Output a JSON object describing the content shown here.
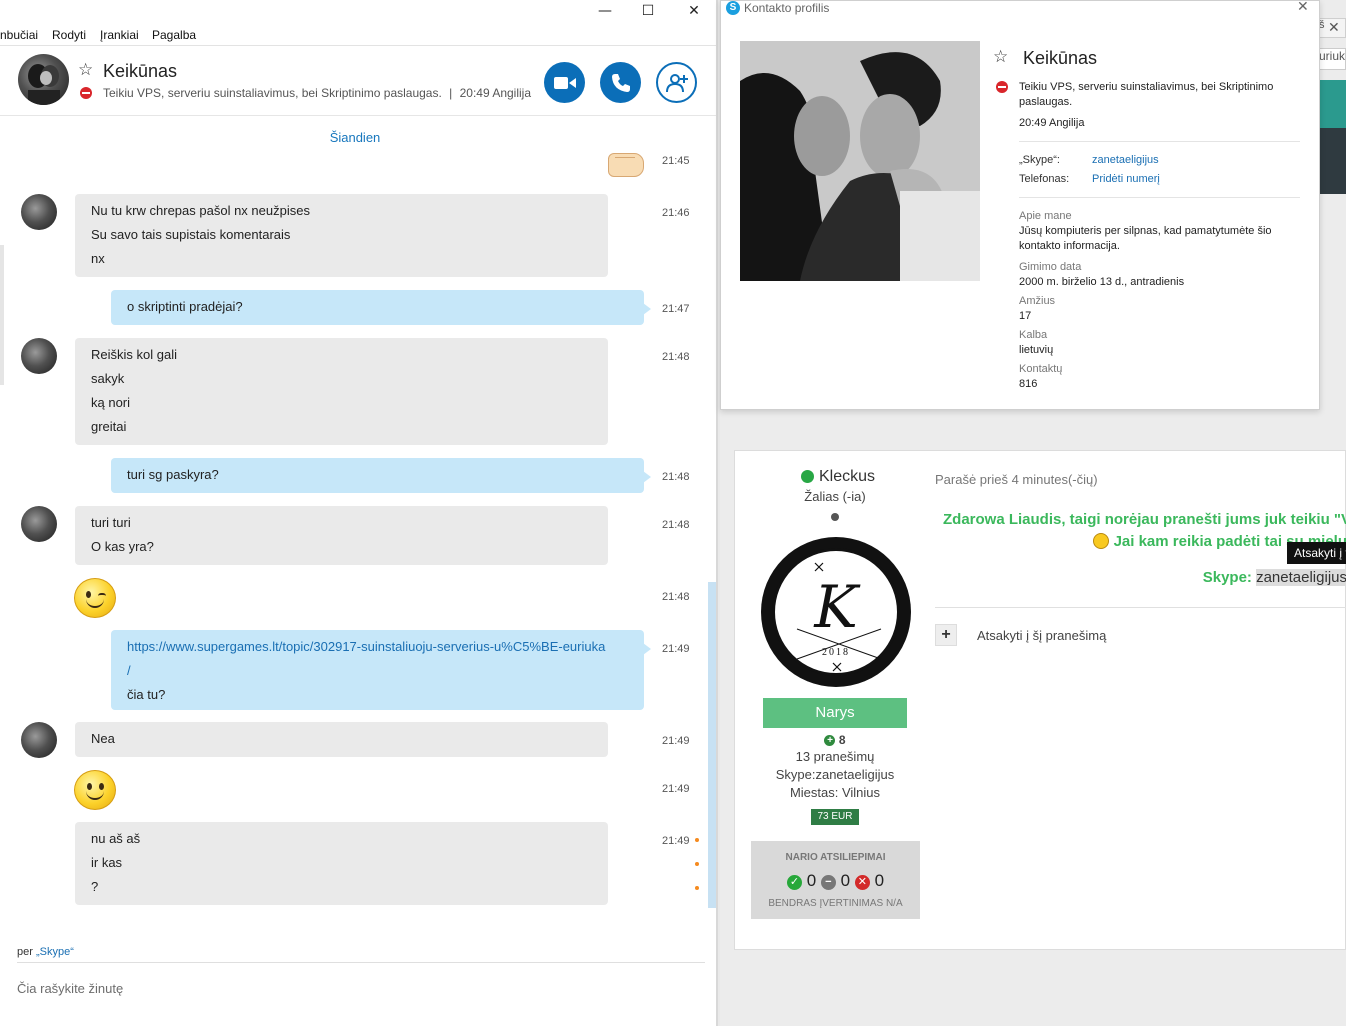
{
  "skype": {
    "menu": [
      "nbučiai",
      "Rodyti",
      "Įrankiai",
      "Pagalba"
    ],
    "window_controls": {
      "minimize": "—",
      "maximize": "☐",
      "close": "✕"
    },
    "contact": {
      "name": "Keikūnas",
      "status_text": "Teikiu VPS, serveriu suinstaliavimus, bei Skriptinimo paslaugas.",
      "local_time": "20:49 Angilija"
    },
    "date_separator": "Šiandien",
    "messages": [
      {
        "dir": "out",
        "kind": "emoji",
        "icon": "fist-bump-icon",
        "time": "21:45"
      },
      {
        "dir": "in",
        "lines": [
          "Nu tu krw chrepas pašol nx neužpises",
          "Su savo tais supistais komentarais",
          "nx"
        ],
        "time": "21:46"
      },
      {
        "dir": "out",
        "lines": [
          "o skriptinti pradėjai?"
        ],
        "time": "21:47"
      },
      {
        "dir": "in",
        "lines": [
          "Reiškis kol gali",
          "sakyk",
          "ką nori",
          "greitai"
        ],
        "time": "21:48"
      },
      {
        "dir": "out",
        "lines": [
          "turi sg paskyra?"
        ],
        "time": "21:48"
      },
      {
        "dir": "in",
        "lines": [
          "turi turi",
          "O kas yra?"
        ],
        "time": "21:48"
      },
      {
        "dir": "in",
        "kind": "emoji",
        "icon": "wink-emoji-icon",
        "time": "21:48"
      },
      {
        "dir": "out",
        "lines": [
          "https://www.supergames.lt/topic/302917-suinstaliuoju-serverius-u%C5%BE-euriuka",
          "/",
          "čia tu?"
        ],
        "time": "21:49"
      },
      {
        "dir": "in",
        "lines": [
          "Nea"
        ],
        "time": "21:49"
      },
      {
        "dir": "in",
        "kind": "emoji",
        "icon": "smile-emoji-icon",
        "time": "21:49"
      },
      {
        "dir": "in",
        "lines": [
          "nu aš aš",
          "ir kas",
          "?"
        ],
        "time": "21:49"
      }
    ],
    "via_prefix": "per",
    "via_link": "„Skype“",
    "compose_placeholder": "Čia rašykite žinutę"
  },
  "profile": {
    "window_title": "Kontakto profilis",
    "name": "Keikūnas",
    "status_text": "Teikiu VPS, serveriu suinstaliavimus, bei Skriptinimo paslaugas.",
    "local_time": "20:49 Angilija",
    "skype_label": "„Skype“:",
    "skype_value": "zanetaeligijus",
    "phone_label": "Telefonas:",
    "phone_value": "Pridėti numerį",
    "about_label": "Apie mane",
    "about_value": "Jūsų kompiuteris per silpnas, kad pamatytumėte šio kontakto informacija.",
    "birthday_label": "Gimimo data",
    "birthday_value": "2000 m. birželio 13 d., antradienis",
    "age_label": "Amžius",
    "age_value": "17",
    "language_label": "Kalba",
    "language_value": "lietuvių",
    "contacts_label": "Kontaktų",
    "contacts_value": "816"
  },
  "forum": {
    "bg_tab_fragment": "š",
    "bg_tab_close": "✕",
    "bg_input_fragment": "uriuk",
    "author": {
      "name": "Kleckus",
      "group": "Žalias (-ia)",
      "badge_letter": "K",
      "badge_year": "2018",
      "rank": "Narys",
      "reputation": "8",
      "posts": "13 pranešimų",
      "skype": "Skype:zanetaeligijus",
      "city": "Miestas: Vilnius",
      "money": "73 EUR"
    },
    "feedback": {
      "title": "NARIO ATSILIEPIMAI",
      "positive": "0",
      "neutral": "0",
      "negative": "0",
      "total": "BENDRAS ĮVERTINIMAS N/A"
    },
    "post": {
      "meta": "Parašė prieš 4 minutes(-čių)",
      "line1": "Zdarowa Liaudis, taigi norėjau pranešti jums juk teikiu \"V",
      "line2": "Jai kam reikia padėti tai su mielu",
      "skype_label": "Skype:",
      "skype_value": "zanetaeligijus",
      "tooltip": "Atsakyti į ta"
    },
    "reply_label": "Atsakyti į šį pranešimą"
  },
  "colors": {
    "skype_blue": "#0b6eb8",
    "outgoing_bubble": "#c6e7f9",
    "incoming_bubble": "#eaeaea",
    "forum_green": "#3bb85c",
    "rank_green": "#5dc081",
    "dnd_red": "#d9262b"
  }
}
